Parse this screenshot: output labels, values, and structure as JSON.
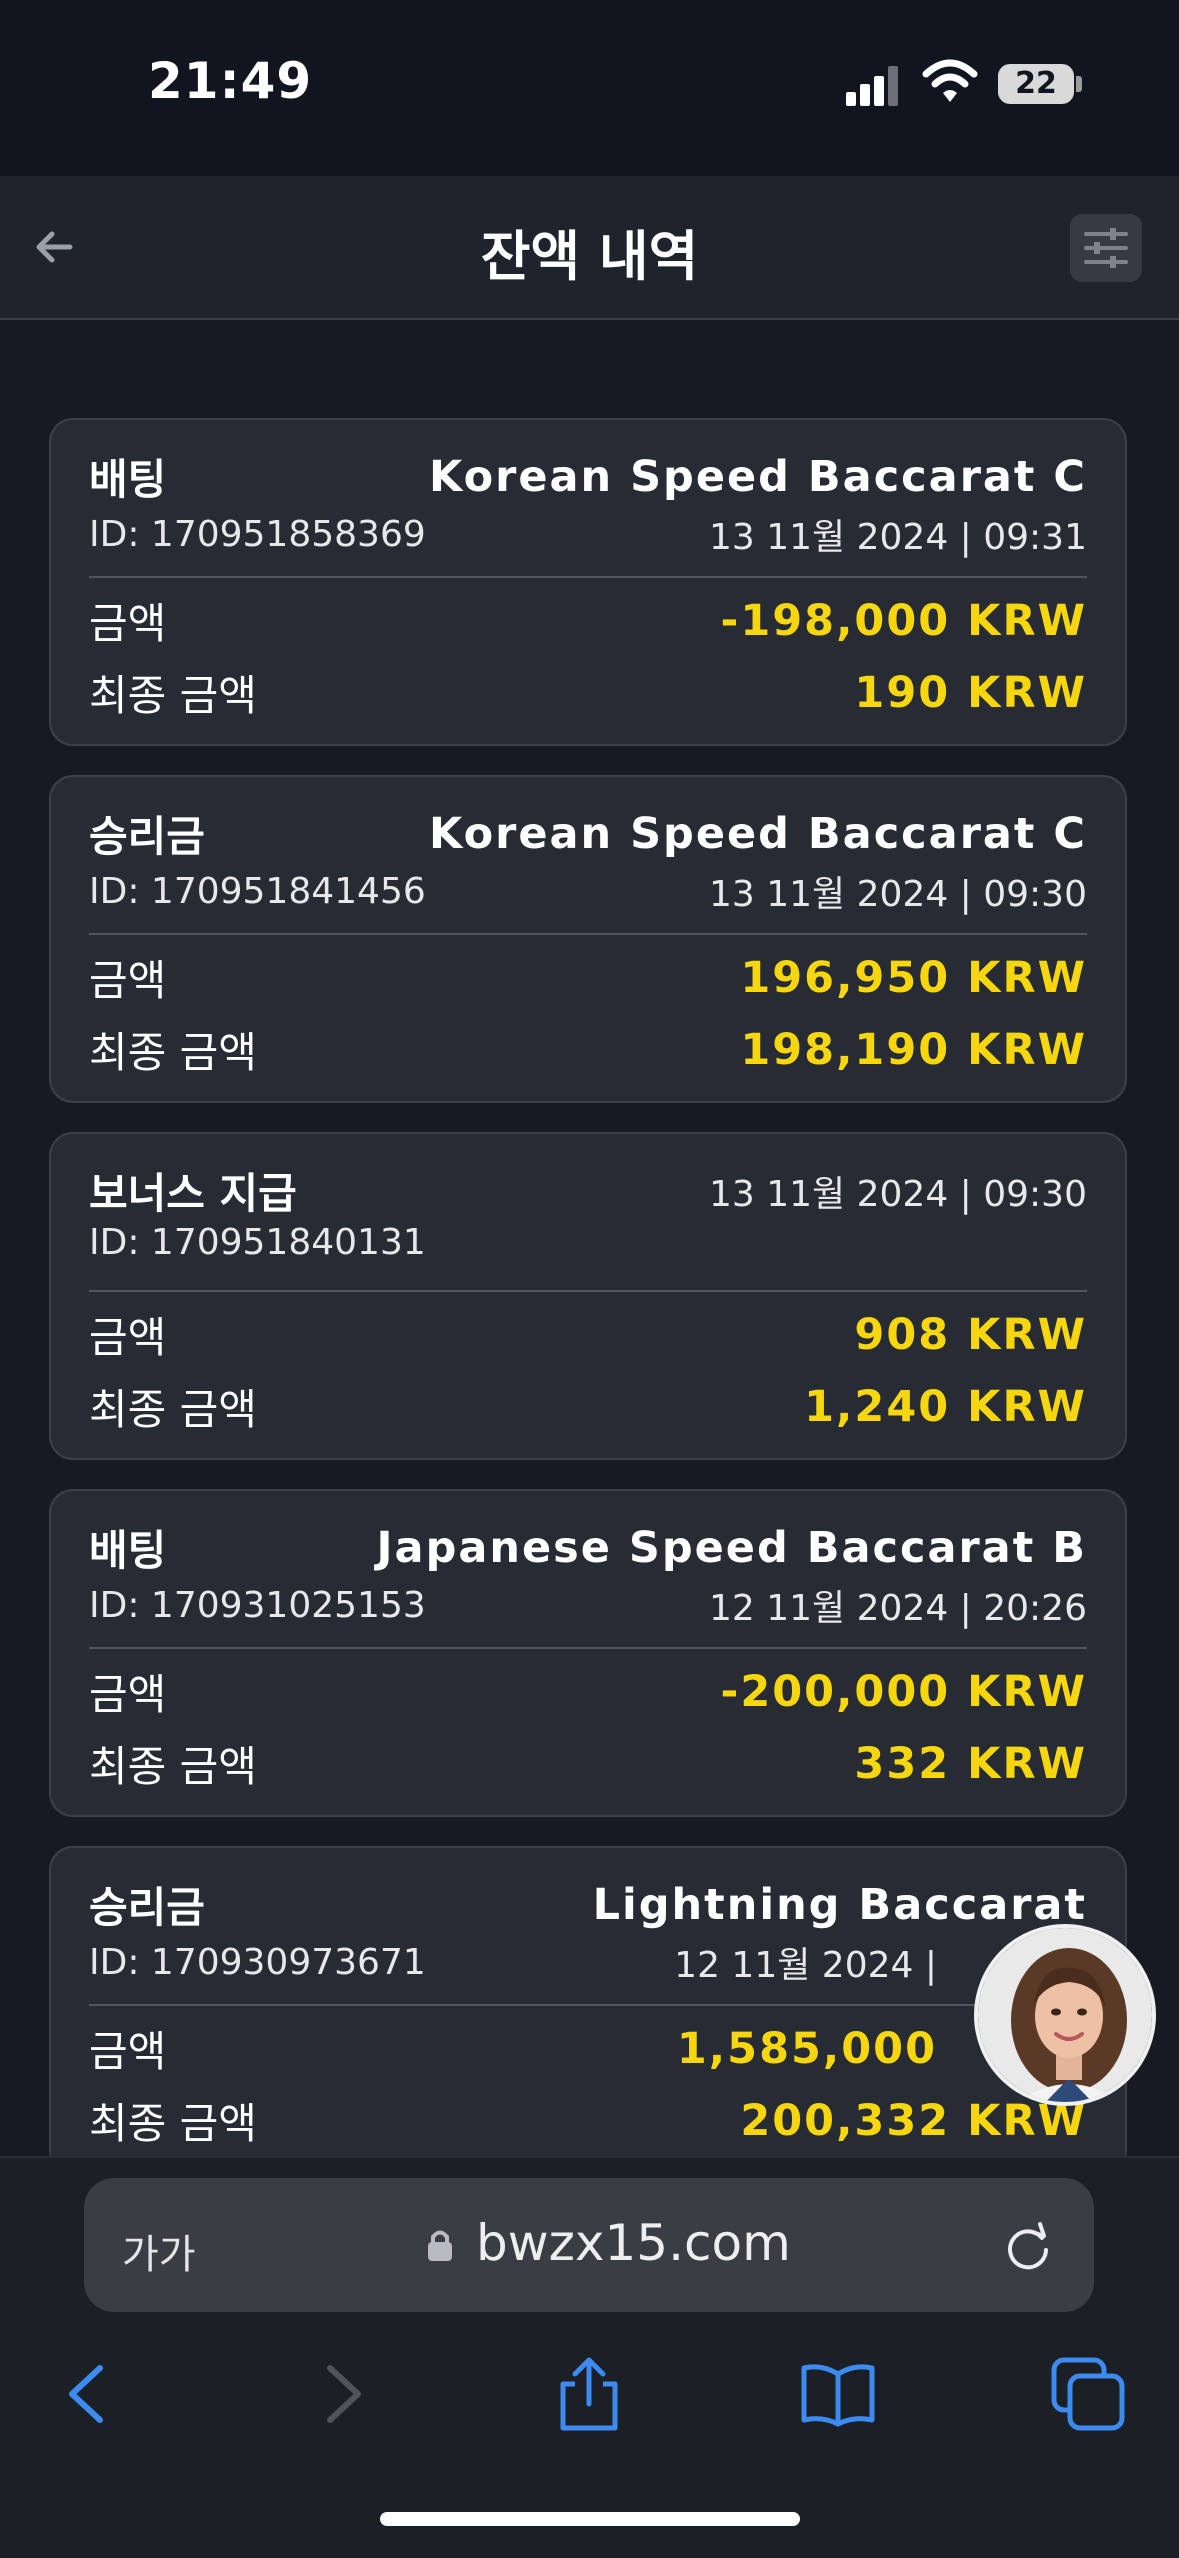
{
  "status_bar": {
    "time": "21:49",
    "battery": "22"
  },
  "header": {
    "title": "잔액 내역"
  },
  "cards": [
    {
      "type": "배팅",
      "game": "Korean Speed Baccarat C",
      "id": "ID: 170951858369",
      "datetime": "13 11월 2024 | 09:31",
      "amount_label": "금액",
      "amount": "-198,000 KRW",
      "final_label": "최종 금액",
      "final_amount": "190 KRW"
    },
    {
      "type": "승리금",
      "game": "Korean Speed Baccarat C",
      "id": "ID: 170951841456",
      "datetime": "13 11월 2024 | 09:30",
      "amount_label": "금액",
      "amount": "196,950 KRW",
      "final_label": "최종 금액",
      "final_amount": "198,190 KRW"
    },
    {
      "type": "보너스 지급",
      "game": "",
      "id": "ID: 170951840131",
      "datetime": "13 11월 2024 | 09:30",
      "amount_label": "금액",
      "amount": "908 KRW",
      "final_label": "최종 금액",
      "final_amount": "1,240 KRW"
    },
    {
      "type": "배팅",
      "game": "Japanese Speed Baccarat B",
      "id": "ID: 170931025153",
      "datetime": "12 11월 2024 | 20:26",
      "amount_label": "금액",
      "amount": "-200,000 KRW",
      "final_label": "최종 금액",
      "final_amount": "332 KRW"
    },
    {
      "type": "승리금",
      "game": "Lightning Baccarat",
      "id": "ID: 170930973671",
      "datetime": "12 11월 2024 |",
      "amount_label": "금액",
      "amount": "1,585,000",
      "final_label": "최종 금액",
      "final_amount": "200,332 KRW"
    }
  ],
  "browser": {
    "text_size": "가가",
    "domain": "bwzx15.com"
  },
  "colors": {
    "accent_amount": "#f5d60f",
    "safari_blue": "#3d8bf0",
    "card_bg": "#262b34"
  },
  "icons": [
    "back-arrow-icon",
    "filter-sliders-icon",
    "lock-icon",
    "reload-icon",
    "nav-back-icon",
    "nav-forward-icon",
    "share-icon",
    "bookmarks-icon",
    "tabs-icon"
  ]
}
